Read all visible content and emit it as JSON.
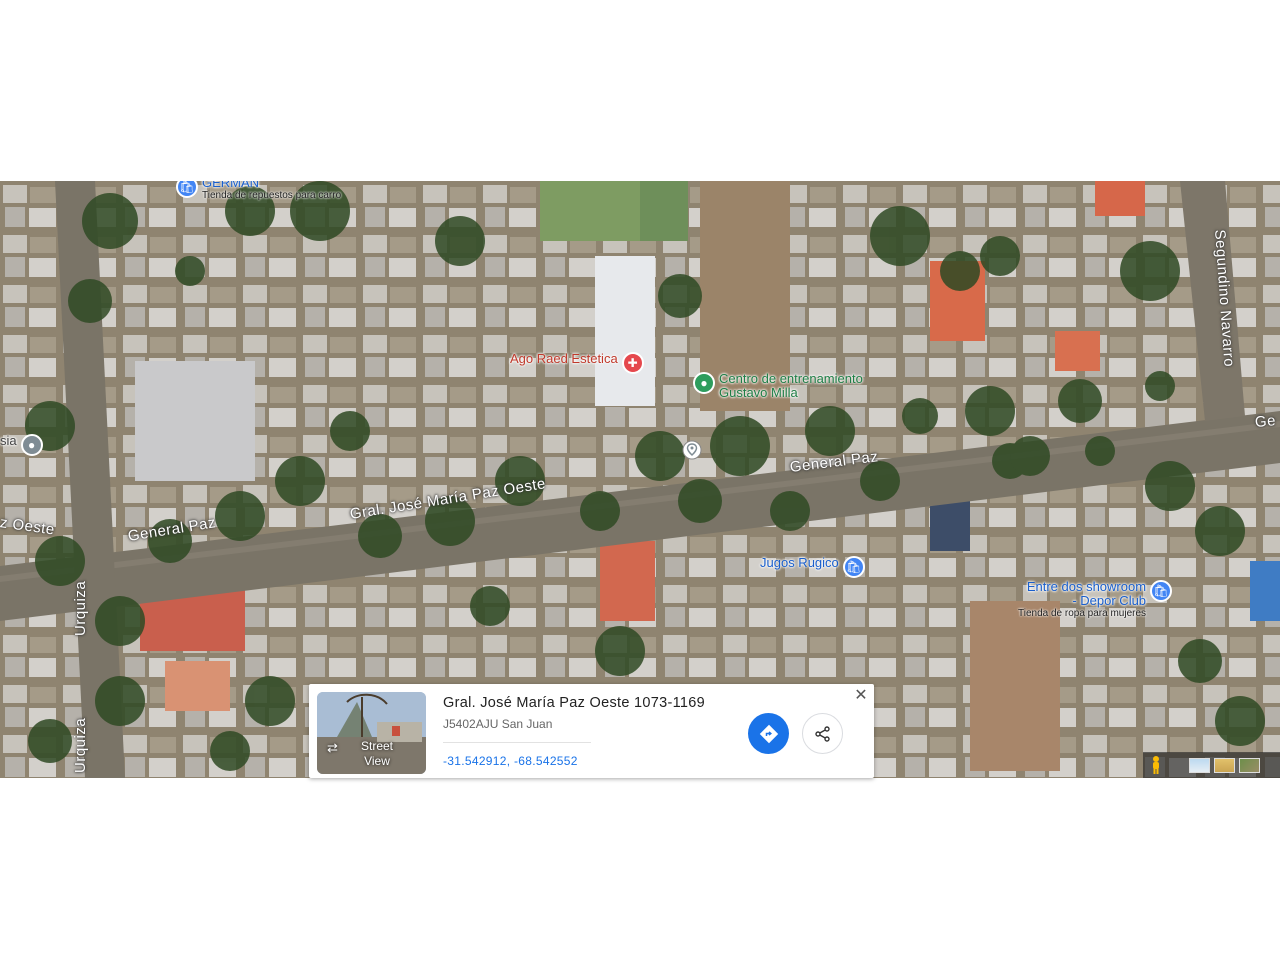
{
  "map": {
    "street_labels": [
      "Urquiza",
      "Urquiza",
      "General Paz",
      "Gral. José María Paz Oeste",
      "General Paz",
      "Segundino Navarro",
      "z Oeste",
      "Ge"
    ],
    "pois": [
      {
        "name": "GERMAN",
        "subtitle": "Tienda de repuestos para carro",
        "icon": "shopping-bag-icon",
        "color": "#4285f4"
      },
      {
        "name": "Ago Raed Estetica",
        "subtitle": "",
        "icon": "medical-icon",
        "color": "#e5484d"
      },
      {
        "name": "Centro de entrenamiento",
        "name2": "Gustavo Milla",
        "subtitle": "",
        "icon": "fitness-icon",
        "color": "#2e9d5d"
      },
      {
        "name": "Jugos Rugico",
        "subtitle": "",
        "icon": "shopping-bag-icon",
        "color": "#4285f4"
      },
      {
        "name": "Entre dos showroom",
        "name2": "- Depor Club",
        "subtitle": "Tienda de ropa para mujeres",
        "icon": "shopping-bag-icon",
        "color": "#4285f4"
      },
      {
        "name": "sia",
        "subtitle": "",
        "icon": "place-icon",
        "color": "#7f8c94"
      }
    ],
    "dropped_pin": "location-pin-icon"
  },
  "card": {
    "street_view_label": "Street View",
    "title": "Gral. José María Paz Oeste 1073-1169",
    "subtitle": "J5402AJU San Juan",
    "coordinates": "-31.542912, -68.542552",
    "directions_icon": "directions-icon",
    "share_icon": "share-icon",
    "close_icon": "close-icon",
    "close_glyph": "✕"
  },
  "controls": {
    "pegman": "pegman-icon",
    "layers": [
      "map-layer-tile",
      "terrain-layer-tile",
      "satellite-layer-tile"
    ]
  },
  "colors": {
    "accent": "#1a73e8",
    "shop_pin": "#4285f4",
    "medical_pin": "#e5484d",
    "gym_pin": "#2e9d5d"
  }
}
